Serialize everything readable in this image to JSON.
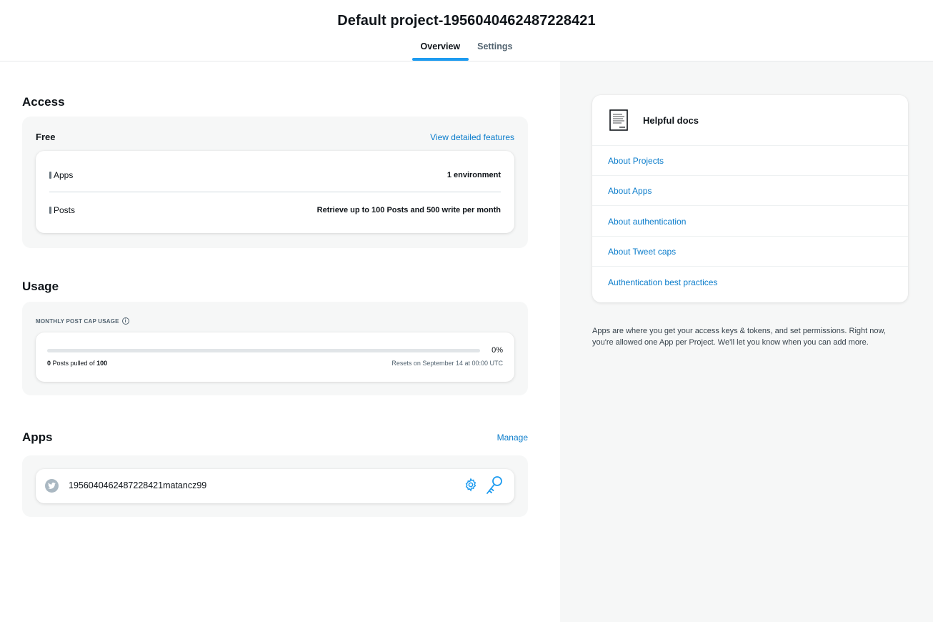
{
  "header": {
    "title": "Default project-1956040462487228421",
    "tabs": [
      {
        "label": "Overview",
        "active": true
      },
      {
        "label": "Settings",
        "active": false
      }
    ]
  },
  "access": {
    "heading": "Access",
    "plan": "Free",
    "view_link": "View detailed features",
    "rows": [
      {
        "label": "Apps",
        "value": "1 environment"
      },
      {
        "label": "Posts",
        "value": "Retrieve up to 100 Posts and 500 write per month"
      }
    ]
  },
  "usage": {
    "heading": "Usage",
    "label": "MONTHLY POST CAP USAGE",
    "info_icon": "info-icon",
    "percent_text": "0%",
    "progress_fraction": 0,
    "pulled": "0",
    "pulled_text": "Posts pulled of",
    "cap": "100",
    "reset_text": "Resets on September 14 at 00:00 UTC"
  },
  "apps": {
    "heading": "Apps",
    "manage_link": "Manage",
    "items": [
      {
        "name": "1956040462487228421matancz99",
        "icon": "twitter-bird-icon"
      }
    ]
  },
  "docs": {
    "title": "Helpful docs",
    "icon": "document-icon",
    "links": [
      "About Projects",
      "About Apps",
      "About authentication",
      "About Tweet caps",
      "Authentication best practices"
    ]
  },
  "note": "Apps are where you get your access keys & tokens, and set permissions. Right now, you're allowed one App per Project. We'll let you know when you can add more.",
  "colors": {
    "accent": "#1d9bf0",
    "link": "#0a7ccb",
    "panel_bg": "#f6f7f7"
  }
}
